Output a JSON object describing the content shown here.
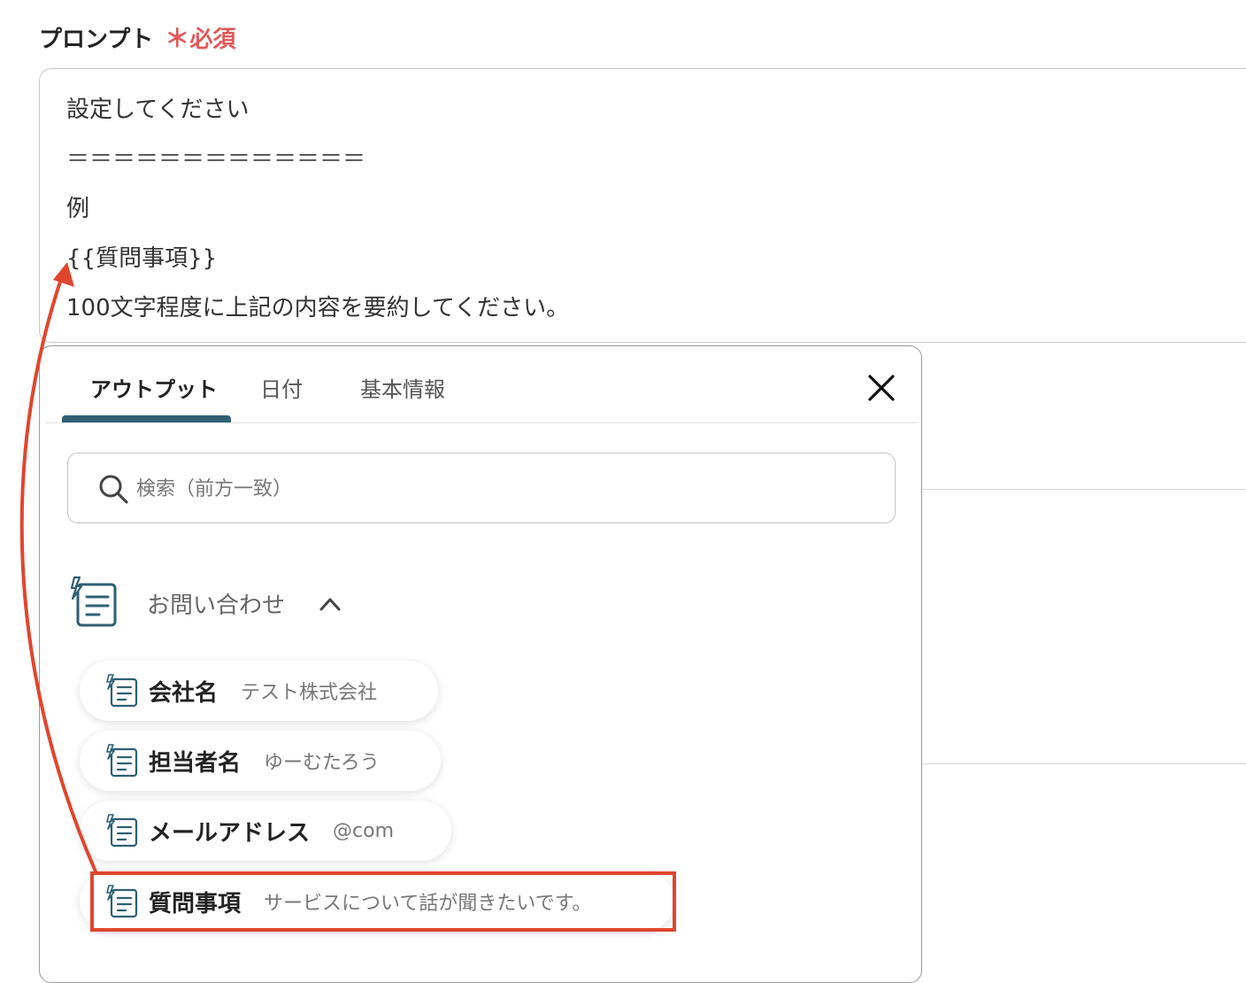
{
  "field": {
    "label": "プロンプト",
    "required_star": "＊",
    "required_text": "必須"
  },
  "prompt": {
    "lines": [
      "設定してください",
      "＝＝＝＝＝＝＝＝＝＝＝＝＝",
      "例",
      "{{質問事項}}",
      "100文字程度に上記の内容を要約してください。"
    ]
  },
  "popup": {
    "tabs": [
      {
        "label": "アウトプット",
        "active": true
      },
      {
        "label": "日付",
        "active": false
      },
      {
        "label": "基本情報",
        "active": false
      }
    ],
    "close_icon": "close-icon",
    "search": {
      "placeholder": "検索（前方一致）",
      "icon": "search-icon"
    },
    "group": {
      "title": "お問い合わせ",
      "icon": "form-icon",
      "expanded": true,
      "items": [
        {
          "key": "会社名",
          "value": "テスト株式会社",
          "highlighted": false
        },
        {
          "key": "担当者名",
          "value": "ゆーむたろう",
          "highlighted": false
        },
        {
          "key": "メールアドレス",
          "value": "@com",
          "highlighted": false
        },
        {
          "key": "質問事項",
          "value": "サービスについて話が聞きたいです。",
          "highlighted": true
        }
      ]
    }
  },
  "colors": {
    "accent": "#2e5f73",
    "required": "#e05a5a",
    "annotation": "#e0462e"
  }
}
